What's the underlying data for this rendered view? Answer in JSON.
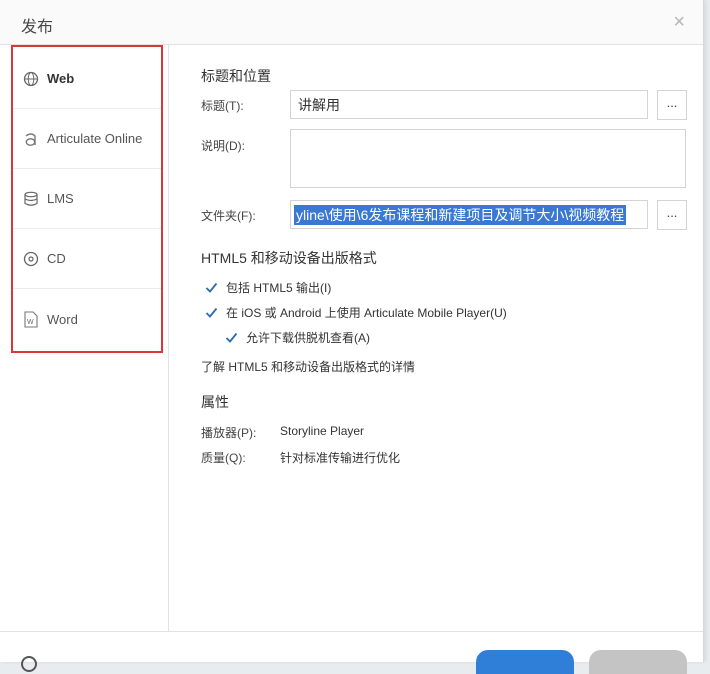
{
  "window": {
    "title": "发布",
    "close_glyph": "×"
  },
  "sidebar": {
    "items": [
      {
        "label": "Web",
        "icon": "globe-icon",
        "active": true
      },
      {
        "label": "Articulate Online",
        "icon": "articulate-icon",
        "active": false
      },
      {
        "label": "LMS",
        "icon": "database-icon",
        "active": false
      },
      {
        "label": "CD",
        "icon": "disc-icon",
        "active": false
      },
      {
        "label": "Word",
        "icon": "document-icon",
        "active": false
      }
    ],
    "highlight_color": "#d9383a"
  },
  "main": {
    "title_section": {
      "heading": "标题和位置",
      "title_label": "标题(T):",
      "title_value": "讲解用",
      "description_label": "说明(D):",
      "description_value": "",
      "folder_label": "文件夹(F):",
      "folder_value": "yline\\使用\\6发布课程和新建项目及调节大小\\视频教程",
      "browse_label": "..."
    },
    "html5_section": {
      "heading": "HTML5 和移动设备出版格式",
      "include_html5": {
        "label": "包括 HTML5 输出(I)",
        "checked": true
      },
      "use_mobile_player": {
        "label": "在 iOS 或 Android 上使用 Articulate Mobile Player(U)",
        "checked": true
      },
      "allow_offline": {
        "label": "允许下载供脱机查看(A)",
        "checked": true
      },
      "learn_more": "了解 HTML5 和移动设备出版格式的详情"
    },
    "properties_section": {
      "heading": "属性",
      "player_label": "播放器(P):",
      "player_value": "Storyline Player",
      "quality_label": "质量(Q):",
      "quality_value": "针对标准传输进行优化"
    }
  },
  "colors": {
    "accent": "#2f7fd8",
    "selection": "#3a78d4",
    "checkmark": "#2b6cb0"
  }
}
